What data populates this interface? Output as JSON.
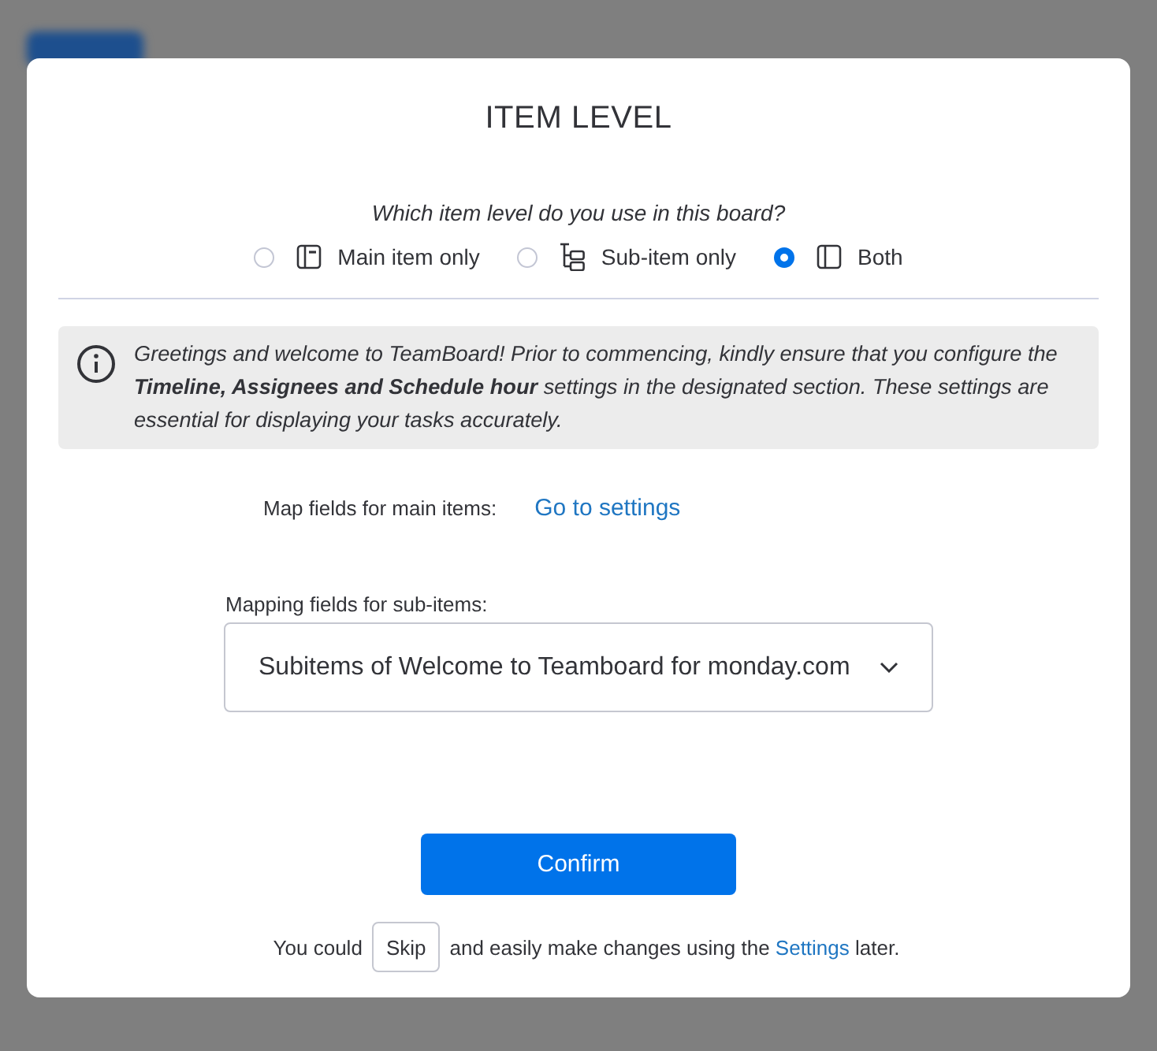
{
  "dialog": {
    "title": "ITEM LEVEL",
    "question": "Which item level do you use in this board?",
    "options": [
      {
        "label": "Main item only",
        "kind": "main",
        "selected": false
      },
      {
        "label": "Sub-item only",
        "kind": "sub",
        "selected": false
      },
      {
        "label": "Both",
        "kind": "both",
        "selected": true
      }
    ],
    "notice": {
      "text": "Greetings and welcome to TeamBoard! Prior to commencing, kindly ensure that you configure the **Timeline, Assignees and Schedule hour** settings in the designated section. These settings are essential for displaying your tasks accurately."
    },
    "main_items": {
      "label": "Map fields for main items:",
      "link": "Go to settings"
    },
    "sub_items": {
      "label": "Mapping fields for sub-items:",
      "value": "Subitems of Welcome to Teamboard for monday.com"
    },
    "confirm_button": "Confirm",
    "footer": {
      "before": "You could",
      "skip_button": "Skip",
      "middle": "and easily make changes using the",
      "link": "Settings",
      "after": "later."
    }
  }
}
